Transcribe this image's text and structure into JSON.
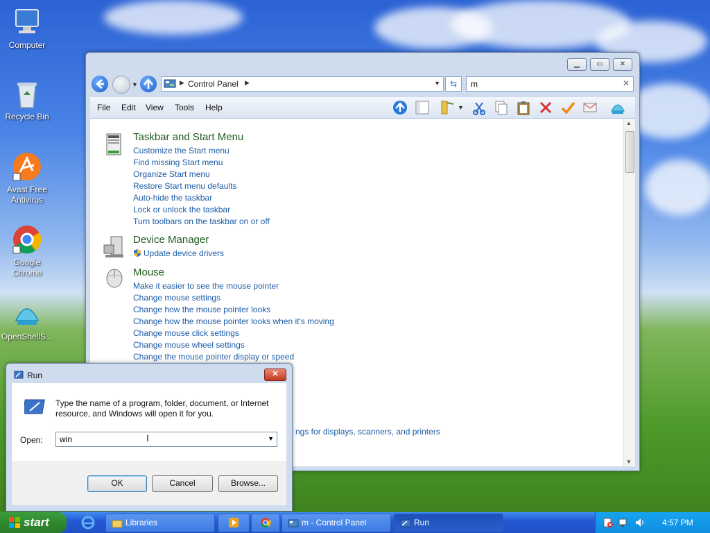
{
  "desktop": {
    "icons": [
      {
        "label": "Computer"
      },
      {
        "label": "Recycle Bin"
      },
      {
        "label": "Avast Free Antivirus"
      },
      {
        "label": "Google Chrome"
      },
      {
        "label": "OpenShellS..."
      }
    ]
  },
  "control_panel": {
    "breadcrumb": "Control Panel",
    "search_value": "m",
    "menu": [
      "File",
      "Edit",
      "View",
      "Tools",
      "Help"
    ],
    "categories": [
      {
        "title": "Taskbar and Start Menu",
        "links": [
          "Customize the Start menu",
          "Find missing Start menu",
          "Organize Start menu",
          "Restore Start menu defaults",
          "Auto-hide the taskbar",
          "Lock or unlock the taskbar",
          "Turn toolbars on the taskbar on or off"
        ]
      },
      {
        "title": "Device Manager",
        "links": [
          "Update device drivers"
        ]
      },
      {
        "title": "Mouse",
        "links": [
          "Make it easier to see the mouse pointer",
          "Change mouse settings",
          "Change how the mouse pointer looks",
          "Change how the mouse pointer looks when it's moving",
          "Change mouse click settings",
          "Change mouse wheel settings",
          "Change the mouse pointer display or speed"
        ]
      }
    ],
    "partial_link": "ngs for displays, scanners, and printers"
  },
  "run_dialog": {
    "title": "Run",
    "description": "Type the name of a program, folder, document, or Internet resource, and Windows will open it for you.",
    "open_label": "Open:",
    "open_value": "win",
    "ok": "OK",
    "cancel": "Cancel",
    "browse": "Browse..."
  },
  "taskbar": {
    "start": "start",
    "tasks": [
      {
        "label": "Libraries"
      },
      {
        "label": ""
      },
      {
        "label": ""
      },
      {
        "label": "m - Control Panel"
      },
      {
        "label": "Run"
      }
    ],
    "clock": "4:57 PM"
  }
}
